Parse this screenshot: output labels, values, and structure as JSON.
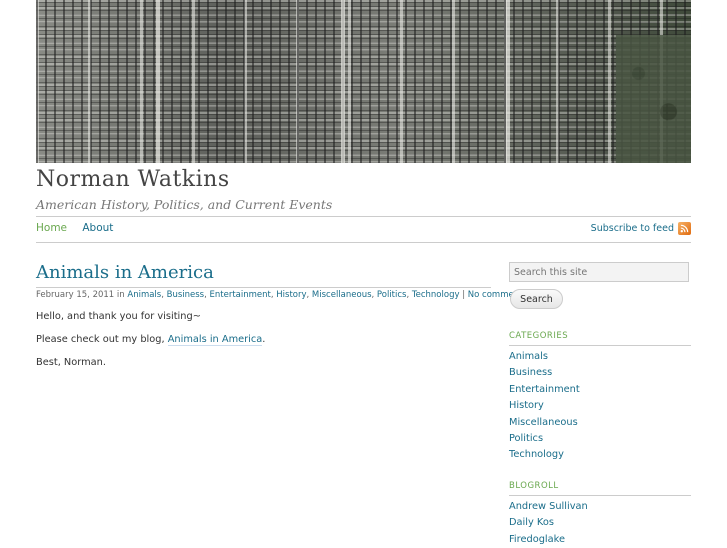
{
  "site": {
    "title": "Norman Watkins",
    "tagline": "American History, Politics, and Current Events"
  },
  "nav": {
    "items": [
      {
        "label": "Home"
      },
      {
        "label": "About"
      }
    ],
    "subscribe_label": "Subscribe to feed",
    "subscribe_icon": "rss-feed-icon"
  },
  "post": {
    "title": "Animals in America",
    "date": "February 15, 2011",
    "in_word": "in",
    "categories": [
      "Animals",
      "Business",
      "Entertainment",
      "History",
      "Miscellaneous",
      "Politics",
      "Technology"
    ],
    "separator": ",",
    "comments_sep": "|",
    "comments_label": "No comments",
    "paragraphs": {
      "p1": "Hello, and thank you for visiting~",
      "p2_prefix": "Please check out my blog, ",
      "p2_link": "Animals in America",
      "p2_suffix": ".",
      "p3": "Best, Norman."
    }
  },
  "sidebar": {
    "search_placeholder": "Search this site",
    "search_button": "Search",
    "categories_title": "CATEGORIES",
    "categories": [
      "Animals",
      "Business",
      "Entertainment",
      "History",
      "Miscellaneous",
      "Politics",
      "Technology"
    ],
    "blogroll_title": "BLOGROLL",
    "blogroll": [
      "Andrew Sullivan",
      "Daily Kos",
      "Firedoglake"
    ]
  },
  "colors": {
    "link": "#1a6d8a",
    "accent_green": "#6aa84f",
    "feed_orange": "#e06b0f"
  }
}
